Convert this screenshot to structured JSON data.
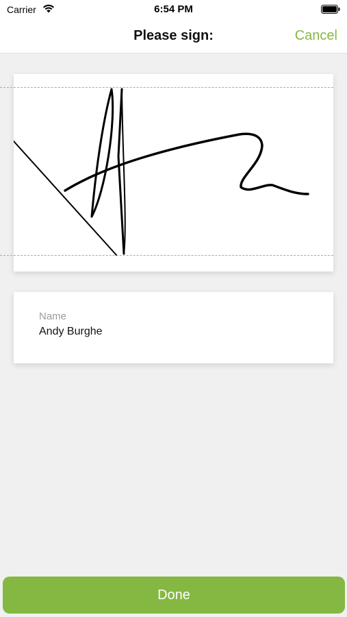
{
  "status_bar": {
    "carrier": "Carrier",
    "time": "6:54 PM",
    "wifi_icon": "wifi-icon",
    "battery_icon": "battery-icon"
  },
  "nav": {
    "title": "Please sign:",
    "cancel_label": "Cancel"
  },
  "signature": {
    "icon": "handwritten-signature"
  },
  "name_field": {
    "label": "Name",
    "value": "Andy Burghe"
  },
  "done_label": "Done",
  "colors": {
    "accent": "#85b843",
    "background": "#f0f0f0"
  }
}
